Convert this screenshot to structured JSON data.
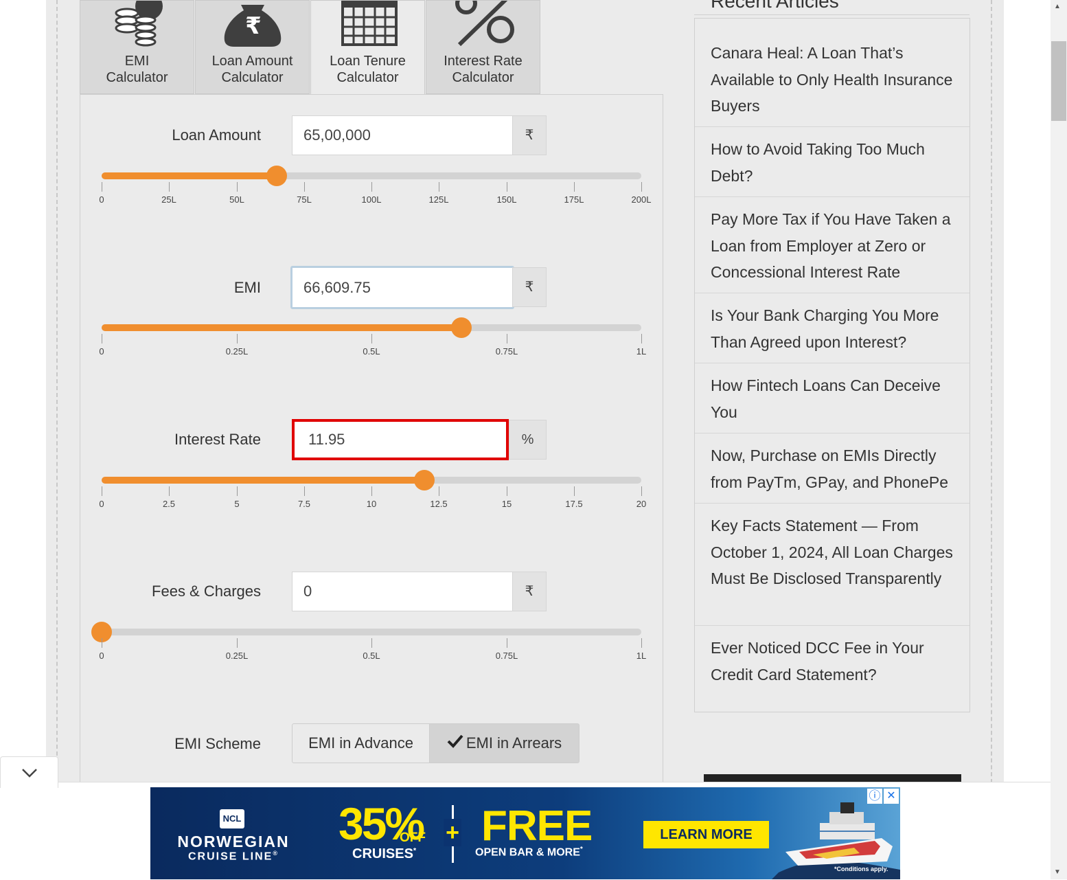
{
  "tabs": [
    {
      "label_line1": "EMI",
      "label_line2": "Calculator",
      "icon": "coins-icon"
    },
    {
      "label_line1": "Loan Amount",
      "label_line2": "Calculator",
      "icon": "rupee-bag-icon"
    },
    {
      "label_line1": "Loan Tenure",
      "label_line2": "Calculator",
      "icon": "calendar-icon"
    },
    {
      "label_line1": "Interest Rate",
      "label_line2": "Calculator",
      "icon": "percent-icon"
    }
  ],
  "fields": {
    "loan_amount": {
      "label": "Loan Amount",
      "value": "65,00,000",
      "unit": "₹",
      "slider_fraction": 0.325,
      "ticks": [
        "0",
        "25L",
        "50L",
        "75L",
        "100L",
        "125L",
        "150L",
        "175L",
        "200L"
      ]
    },
    "emi": {
      "label": "EMI",
      "value": "66,609.75",
      "unit": "₹",
      "slider_fraction": 0.667,
      "ticks": [
        "0",
        "0.25L",
        "0.5L",
        "0.75L",
        "1L"
      ]
    },
    "interest_rate": {
      "label": "Interest Rate",
      "value": "11.95",
      "unit": "%",
      "slider_fraction": 0.5975,
      "ticks": [
        "0",
        "2.5",
        "5",
        "7.5",
        "10",
        "12.5",
        "15",
        "17.5",
        "20"
      ]
    },
    "fees": {
      "label": "Fees & Charges",
      "value": "0",
      "unit": "₹",
      "slider_fraction": 0.0,
      "ticks": [
        "0",
        "0.25L",
        "0.5L",
        "0.75L",
        "1L"
      ]
    }
  },
  "emi_scheme": {
    "label": "EMI Scheme",
    "option_advance": "EMI in Advance",
    "option_arrears": "EMI in Arrears",
    "selected": "arrears"
  },
  "sidebar": {
    "heading": "Recent Articles",
    "articles": [
      "Canara Heal: A Loan That’s Available to Only Health Insurance Buyers",
      "How to Avoid Taking Too Much Debt?",
      "Pay More Tax if You Have Taken a Loan from Employer at Zero or Concessional Interest Rate",
      "Is Your Bank Charging You More Than Agreed upon Interest?",
      "How Fintech Loans Can Deceive You",
      "Now, Purchase on EMIs Directly from PayTm, GPay, and PhonePe",
      "Key Facts Statement — From October 1, 2024, All Loan Charges Must Be Disclosed Transparently",
      "Ever Noticed DCC Fee in Your Credit Card Statement?"
    ]
  },
  "ad": {
    "brand_badge": "NCL",
    "brand_line1": "NORWEGIAN",
    "brand_line2": "CRUISE LINE",
    "brand_mark": "®",
    "discount": "35%",
    "discount_off": "OFF",
    "discount_sub": "CRUISES",
    "discount_mark": "*",
    "plus": "+",
    "free": "FREE",
    "free_sub": "OPEN BAR & MORE",
    "free_mark": "*",
    "cta": "LEARN MORE",
    "disclaimer": "*Conditions apply.",
    "info_icon": "ⓘ",
    "close_icon": "✕"
  },
  "colors": {
    "accent": "#f08e2e",
    "active_input_border": "#e00000",
    "focused_input_border": "#b9cfe0",
    "ad_yellow": "#ffe600"
  }
}
